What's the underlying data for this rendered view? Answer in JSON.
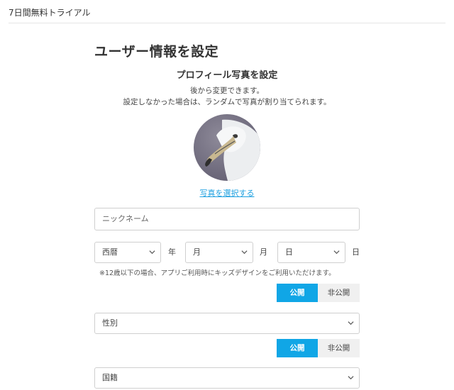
{
  "app": {
    "trial_label": "7日間無料トライアル"
  },
  "page": {
    "heading": "ユーザー情報を設定",
    "photo": {
      "title": "プロフィール写真を設定",
      "note1": "後から変更できます。",
      "note2": "設定しなかった場合は、ランダムで写真が割り当てられます。",
      "select_link": "写真を選択する",
      "avatar_icon": "seagull-photo"
    },
    "nickname": {
      "placeholder": "ニックネーム"
    },
    "birthday": {
      "year": {
        "selected": "西暦",
        "unit": "年"
      },
      "month": {
        "selected": "月",
        "unit": "月"
      },
      "day": {
        "selected": "日",
        "unit": "日"
      }
    },
    "kids_note": "※12歳以下の場合、アプリご利用時にキッズデザインをご利用いただけます。",
    "privacy1": {
      "public": "公開",
      "private": "非公開"
    },
    "gender": {
      "selected": "性別"
    },
    "privacy2": {
      "public": "公開",
      "private": "非公開"
    },
    "country": {
      "selected": "国籍"
    }
  },
  "colors": {
    "accent": "#10a6e6",
    "link": "#1ea0e0"
  }
}
